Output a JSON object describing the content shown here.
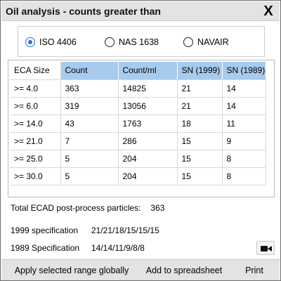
{
  "window": {
    "title": "Oil analysis - counts greater than",
    "close_glyph": "X"
  },
  "standards": {
    "selected": "ISO 4406",
    "options": [
      "ISO 4406",
      "NAS 1638",
      "NAVAIR"
    ]
  },
  "table": {
    "headers": [
      "ECA Size",
      "Count",
      "Count/ml",
      "SN (1999)",
      "SN (1989)"
    ],
    "rows": [
      [
        ">= 4.0",
        "363",
        "14825",
        "21",
        "14"
      ],
      [
        ">= 6.0",
        "319",
        "13056",
        "21",
        "14"
      ],
      [
        ">= 14.0",
        "43",
        "1763",
        "18",
        "11"
      ],
      [
        ">= 21.0",
        "7",
        "286",
        "15",
        "9"
      ],
      [
        ">= 25.0",
        "5",
        "204",
        "15",
        "8"
      ],
      [
        ">= 30.0",
        "5",
        "204",
        "15",
        "8"
      ]
    ]
  },
  "total": {
    "label": "Total ECAD post-process particles:",
    "value": "363"
  },
  "specs": [
    {
      "label": "1999 specification",
      "value": "21/21/18/15/15/15"
    },
    {
      "label": "1989 Specification",
      "value": "14/14/11/9/8/8"
    }
  ],
  "buttons": {
    "apply": "Apply selected range globally",
    "add": "Add to spreadsheet",
    "print": "Print"
  },
  "icons": {
    "close": "close-icon",
    "camera": "camera-icon"
  },
  "colors": {
    "header_bg": "#a7cbef",
    "radio_selected": "#2d6fd9",
    "bar_bg": "#e3e3e3"
  }
}
